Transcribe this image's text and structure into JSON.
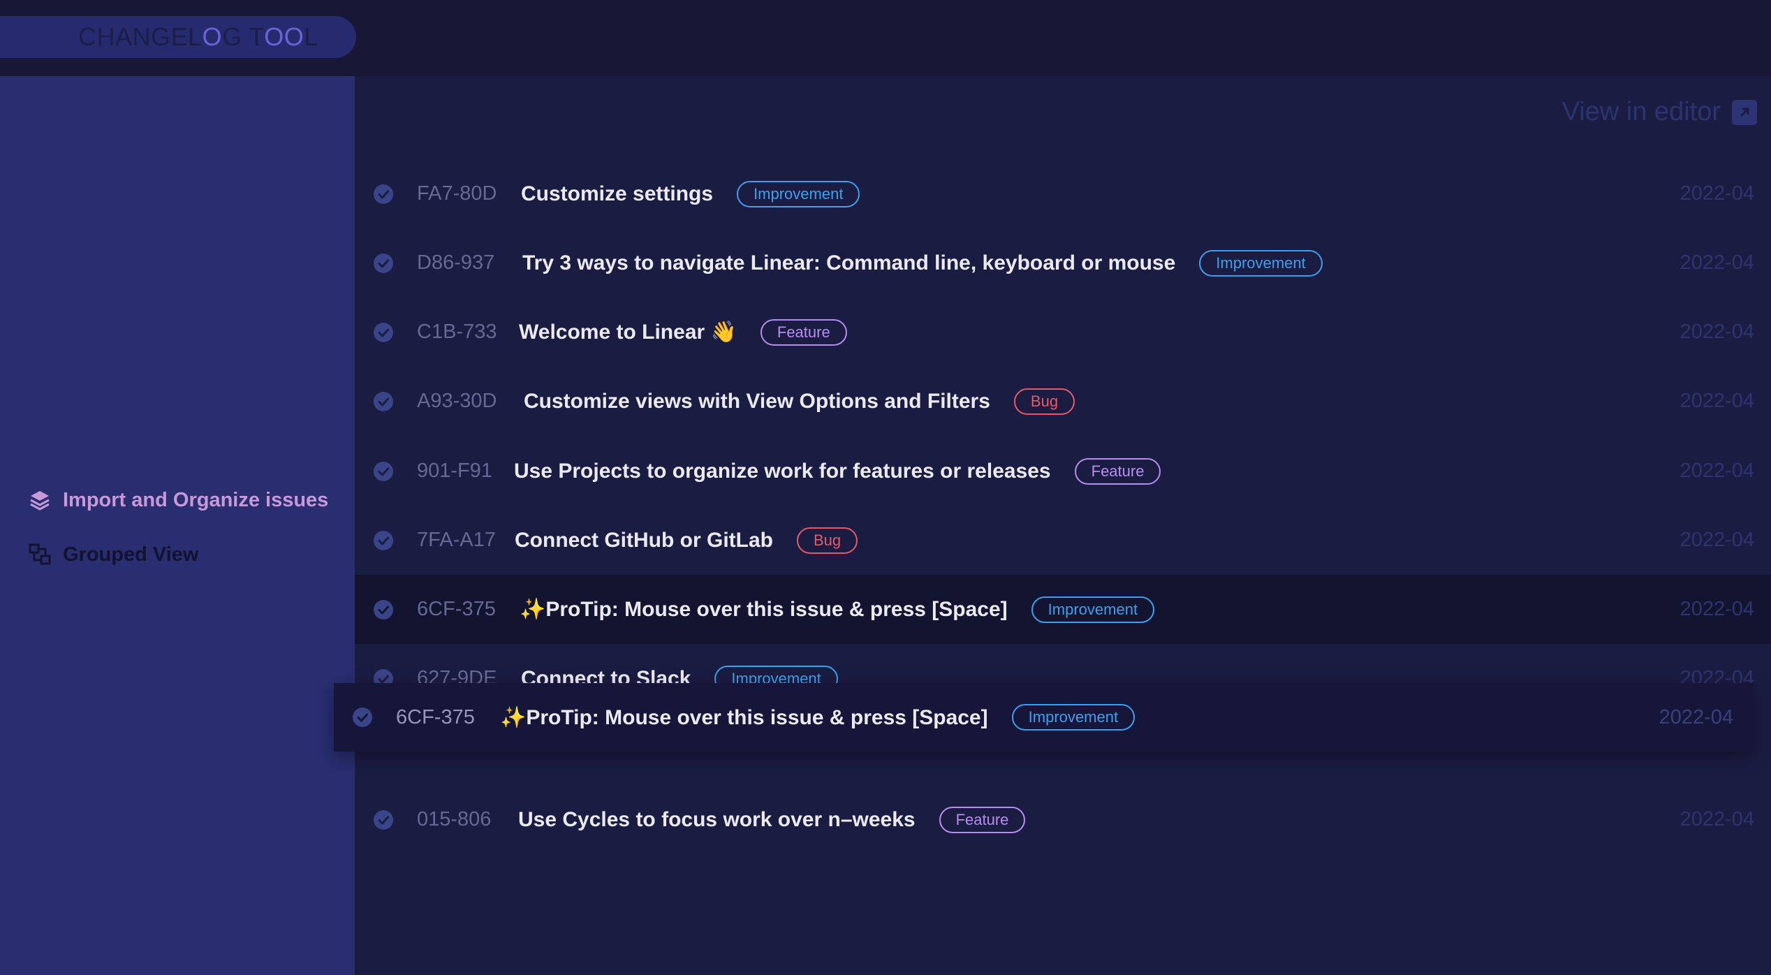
{
  "app": {
    "title_parts": [
      {
        "text": "CHANGEL",
        "hl": false
      },
      {
        "text": "O",
        "hl": true
      },
      {
        "text": "G T",
        "hl": false
      },
      {
        "text": "OO",
        "hl": true
      },
      {
        "text": "L",
        "hl": false
      }
    ]
  },
  "sidebar": {
    "items": [
      {
        "label": "Import and Organize issues",
        "icon": "layers-icon",
        "active": true
      },
      {
        "label": "Grouped View",
        "icon": "grouped-view-icon",
        "active": false
      }
    ]
  },
  "header": {
    "view_in_editor": "View in editor",
    "icon": "external-link-icon"
  },
  "issues": [
    {
      "id": "FA7-80D",
      "title": "Customize settings",
      "tag": "Improvement",
      "date": "2022-04"
    },
    {
      "id": "D86-937",
      "title": "Try 3 ways to navigate Linear: Command line, keyboard or mouse",
      "tag": "Improvement",
      "date": "2022-04"
    },
    {
      "id": "C1B-733",
      "title": "Welcome to Linear 👋",
      "tag": "Feature",
      "date": "2022-04"
    },
    {
      "id": "A93-30D",
      "title": "Customize views with View Options and Filters",
      "tag": "Bug",
      "date": "2022-04"
    },
    {
      "id": "901-F91",
      "title": "Use Projects to organize work for features or releases",
      "tag": "Feature",
      "date": "2022-04"
    },
    {
      "id": "7FA-A17",
      "title": "Connect GitHub or GitLab",
      "tag": "Bug",
      "date": "2022-04"
    },
    {
      "id": "6CF-375",
      "title": "✨ProTip: Mouse over this issue & press [Space]",
      "tag": "Improvement",
      "date": "2022-04",
      "hover": true
    },
    {
      "id": "627-9DE",
      "title": "Connect to Slack",
      "tag": "Improvement",
      "date": "2022-04"
    },
    {
      "id": "",
      "title": "",
      "tag": "",
      "date": "",
      "placeholder": true
    },
    {
      "id": "015-806",
      "title": "Use Cycles to focus work over n–weeks",
      "tag": "Feature",
      "date": "2022-04"
    }
  ],
  "dragging": {
    "id": "6CF-375",
    "title": "✨ProTip: Mouse over this issue & press [Space]",
    "tag": "Improvement",
    "date": "2022-04"
  },
  "colors": {
    "accent": "#6b63d6",
    "improvement": "#3ca0ee",
    "feature": "#b78ef0",
    "bug": "#e45a6a"
  }
}
